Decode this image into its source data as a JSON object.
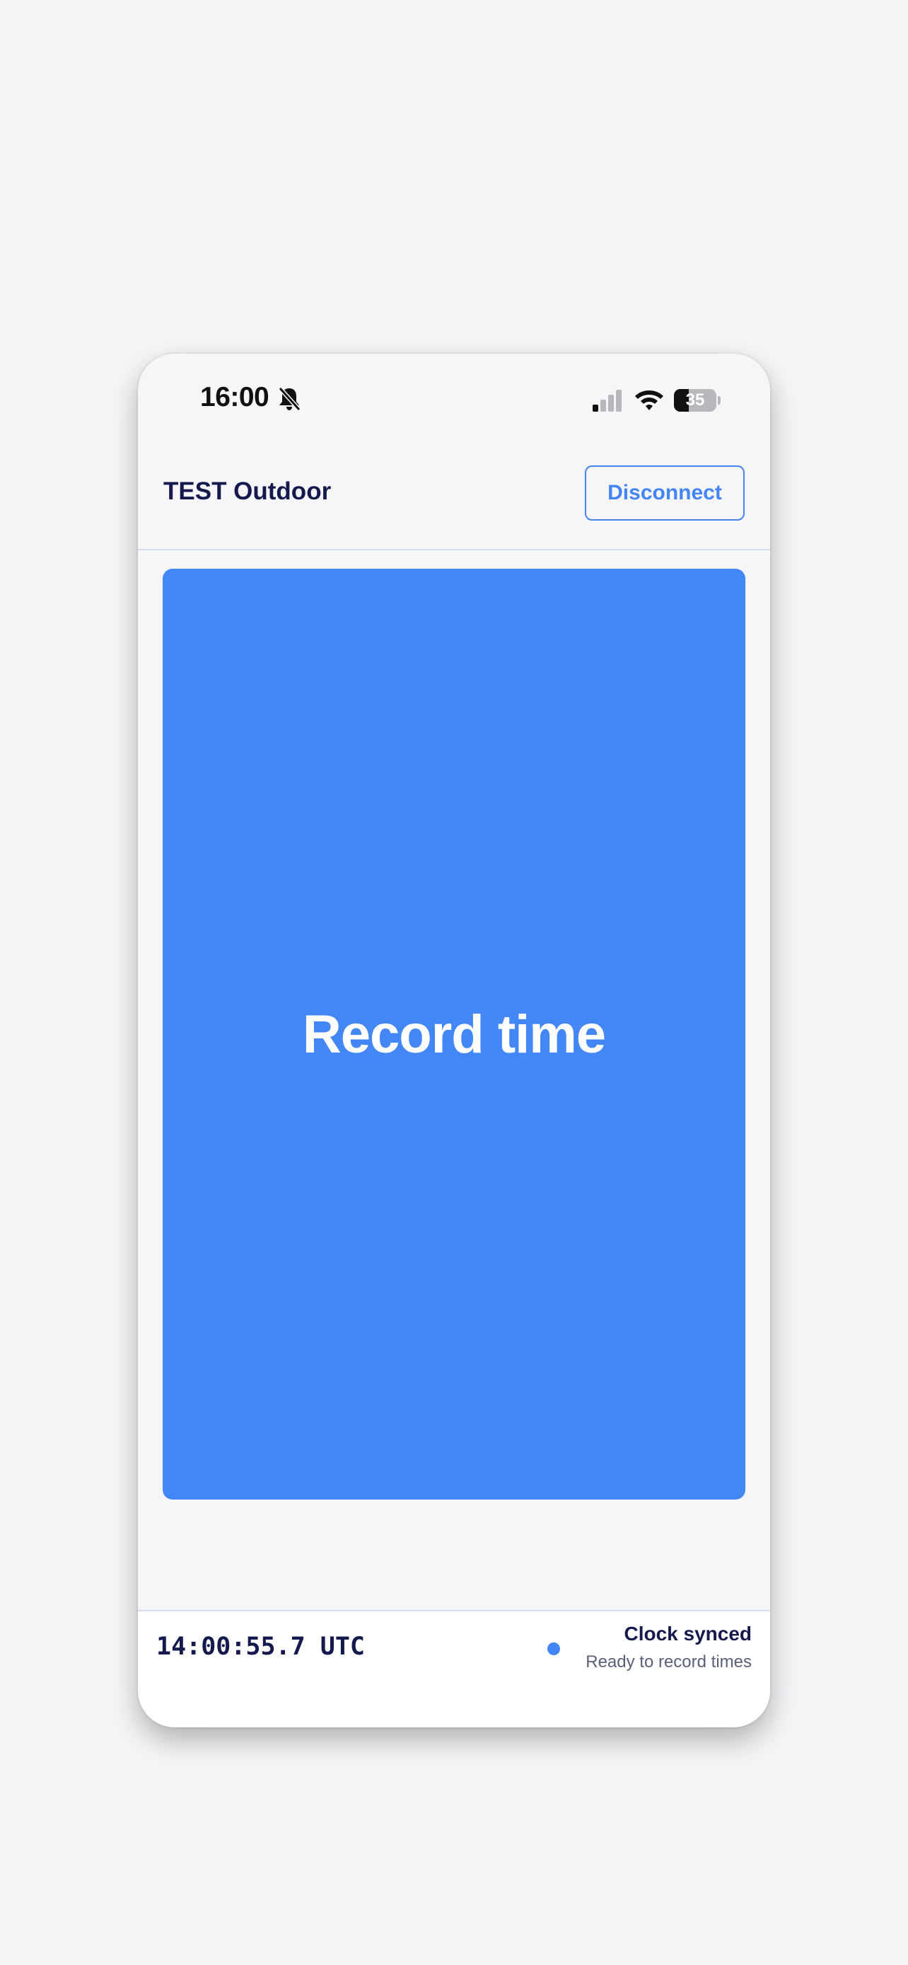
{
  "status_bar": {
    "time": "16:00",
    "battery_level": "35",
    "battery_fraction": 0.35,
    "icons": [
      "bell-slash-icon",
      "cellular-signal-icon",
      "wifi-icon",
      "battery-icon"
    ]
  },
  "header": {
    "title": "TEST Outdoor",
    "disconnect_label": "Disconnect"
  },
  "main": {
    "record_label": "Record time"
  },
  "footer": {
    "clock": "14:00:55.7 UTC",
    "sync_status": "Clock synced",
    "sync_detail": "Ready to record times"
  },
  "colors": {
    "accent": "#4385f4",
    "record_button": "#4387f6",
    "text_dark": "#141a4d",
    "background": "#f6f6f9"
  }
}
